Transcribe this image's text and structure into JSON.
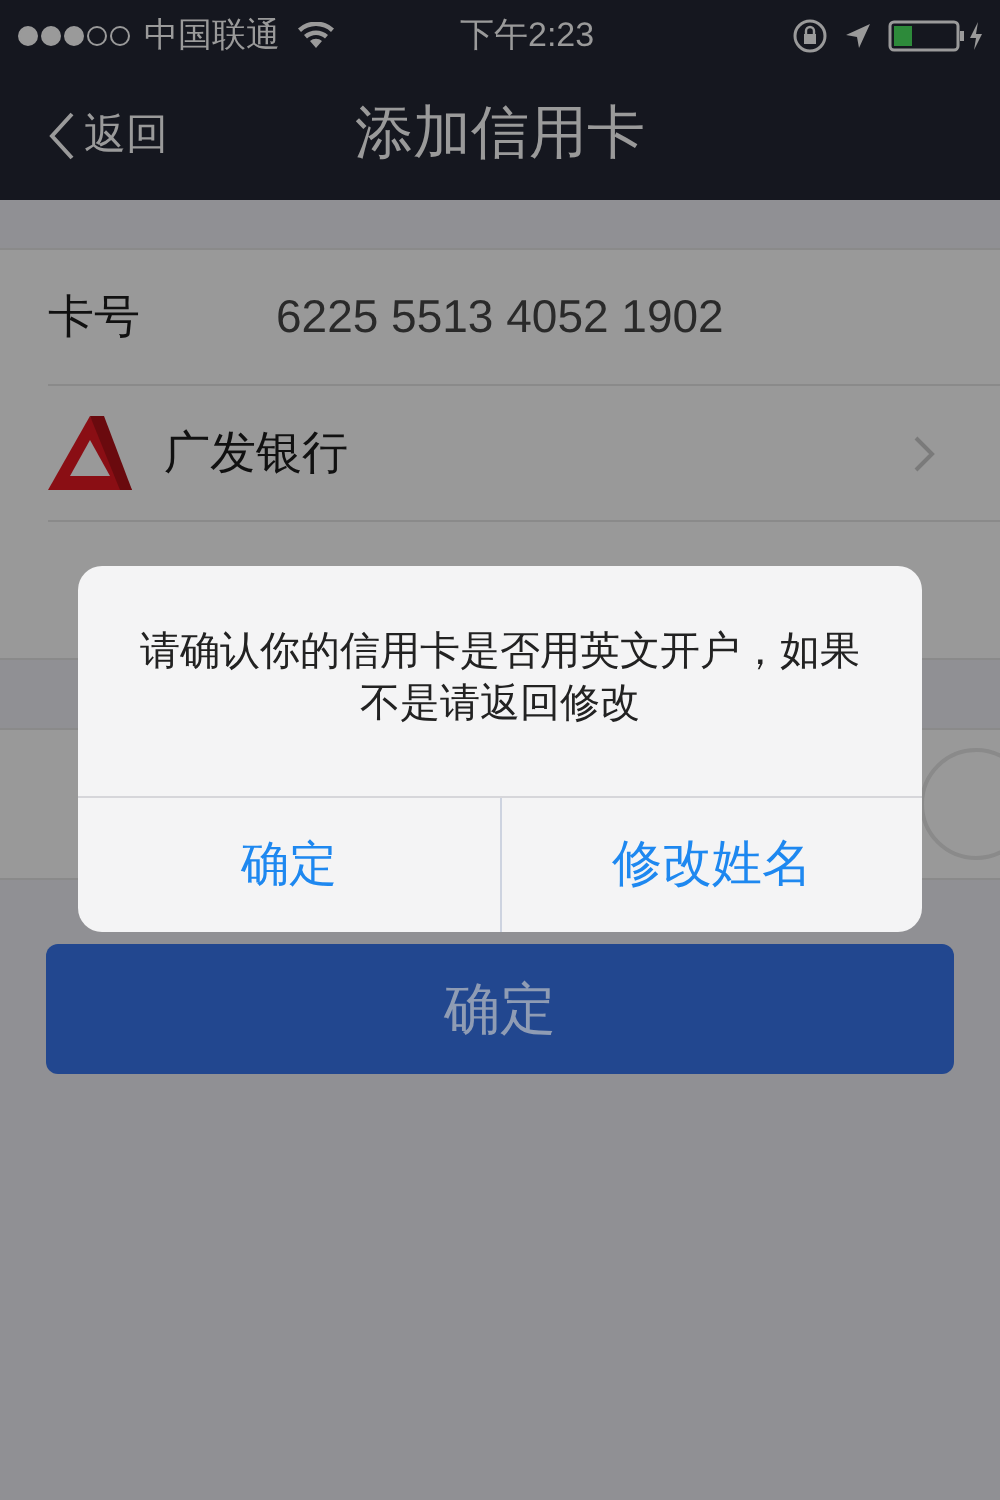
{
  "status_bar": {
    "carrier": "中国联通",
    "time": "下午2:23"
  },
  "nav_bar": {
    "back_label": "返回",
    "title": "添加信用卡"
  },
  "form": [
    {
      "kind": "field",
      "label": "卡号",
      "value": "6225 5513 4052 1902"
    },
    {
      "kind": "bank",
      "label": "广发银行"
    },
    {
      "kind": "field"
    }
  ],
  "form_2": [
    {
      "kind": "toggle"
    }
  ],
  "submit_button": "确定",
  "alert": {
    "message": "请确认你的信用卡是否用英文开户，如果不是请返回修改",
    "buttons": [
      "确定",
      "修改姓名"
    ]
  }
}
